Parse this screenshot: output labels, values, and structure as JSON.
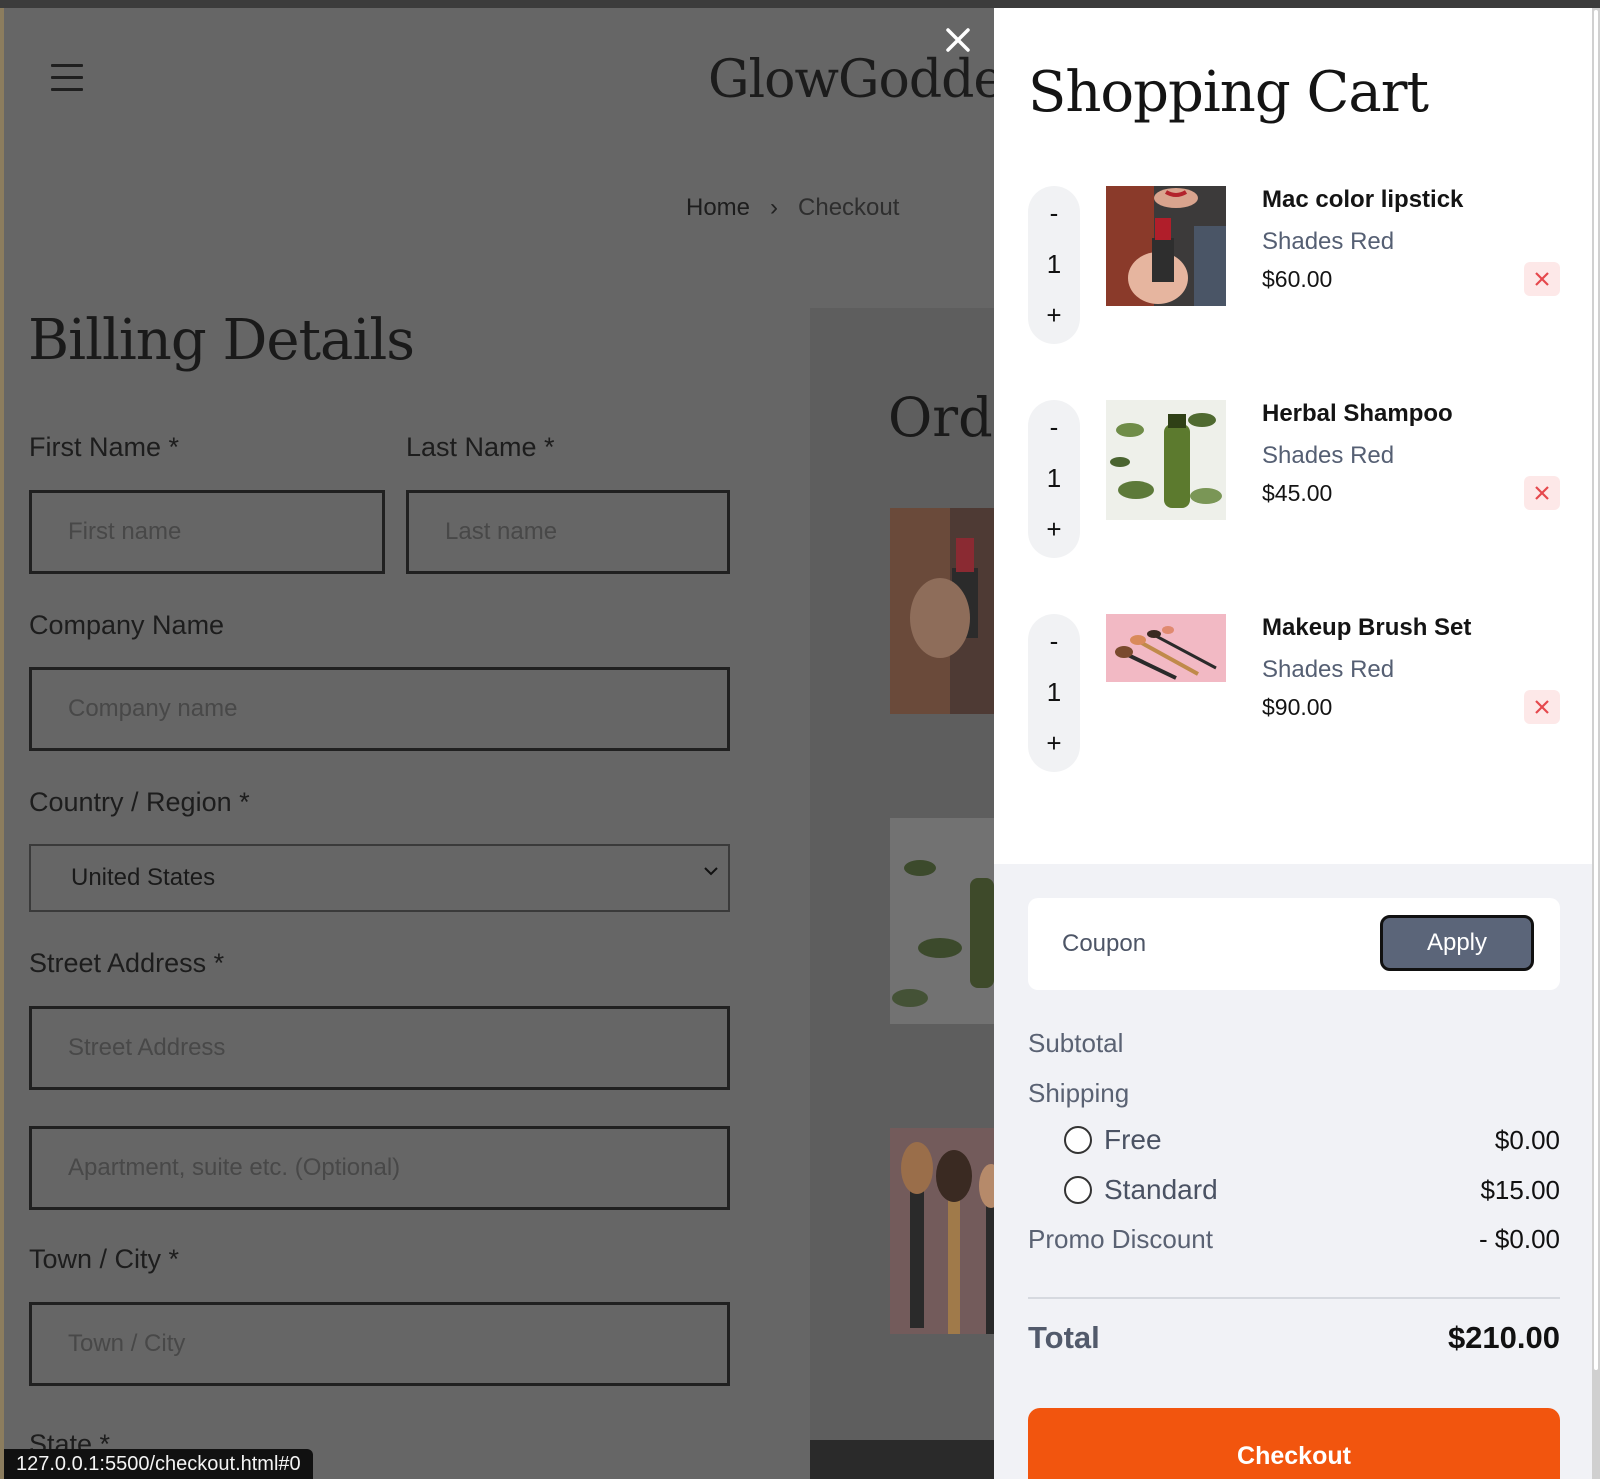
{
  "brand": {
    "name": "GlowGoddess"
  },
  "breadcrumb": {
    "home": "Home",
    "separator": "›",
    "current": "Checkout"
  },
  "billing": {
    "title": "Billing Details",
    "first_name_label": "First Name *",
    "first_name_placeholder": "First name",
    "last_name_label": "Last Name *",
    "last_name_placeholder": "Last name",
    "company_label": "Company Name",
    "company_placeholder": "Company name",
    "country_label": "Country / Region *",
    "country_value": "United States",
    "street_label": "Street Address *",
    "street_placeholder": "Street Address",
    "apartment_placeholder": "Apartment, suite etc. (Optional)",
    "city_label": "Town / City *",
    "city_placeholder": "Town / City",
    "state_label": "State *"
  },
  "order": {
    "title_partial": "Orde"
  },
  "status_url": "127.0.0.1:5500/checkout.html#0",
  "cart": {
    "title": "Shopping Cart",
    "close_icon": "close-icon",
    "items": [
      {
        "name": "Mac color lipstick",
        "shade": "Shades Red",
        "price": "$60.00",
        "qty": "1",
        "minus": "-",
        "plus": "+"
      },
      {
        "name": "Herbal Shampoo",
        "shade": "Shades Red",
        "price": "$45.00",
        "qty": "1",
        "minus": "-",
        "plus": "+"
      },
      {
        "name": "Makeup Brush Set",
        "shade": "Shades Red",
        "price": "$90.00",
        "qty": "1",
        "minus": "-",
        "plus": "+"
      }
    ],
    "coupon_placeholder": "Coupon",
    "apply_label": "Apply",
    "subtotal_label": "Subtotal",
    "shipping_label": "Shipping",
    "shipping_options": [
      {
        "label": "Free",
        "price": "$0.00"
      },
      {
        "label": "Standard",
        "price": "$15.00"
      }
    ],
    "promo_label": "Promo Discount",
    "promo_value": "- $0.00",
    "total_label": "Total",
    "total_value": "$210.00",
    "checkout_label": "Checkout"
  },
  "colors": {
    "accent": "#f2550e",
    "apply_button": "#5b6579",
    "remove_icon": "#e5484d",
    "summary_bg": "#f1f2f6"
  }
}
